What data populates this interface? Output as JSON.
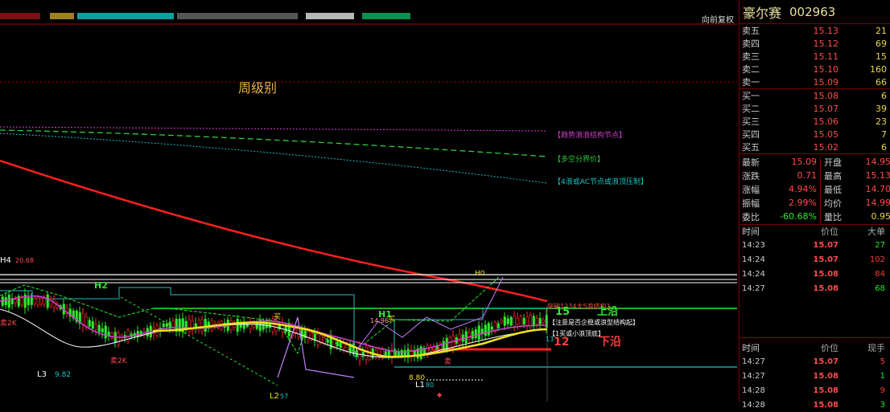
{
  "chart": {
    "adjust_label": "向前复权",
    "period_label": "周级别",
    "annotations": {
      "trend_node": "【趋势浪浪结构节点】",
      "bull_bear": "【多空分界价】",
      "wave4": "【4浪或AC节点或浪顶压制】",
      "break_up": "突破1234大5浪结构1",
      "attention": "【注意是否企稳或浪型结构起】",
      "buy": "【1买或小浪顶底】",
      "up_15": "15",
      "up_rail": "上沿",
      "down_12": "12",
      "down_rail": "下沿",
      "h4": "H4",
      "h4_val": "20.68",
      "h2": "H2",
      "h1": "H1",
      "h1_val": "14.96",
      "h0": "H0",
      "l3": "L3",
      "l3_val": "9.82",
      "l2": "L2",
      "l2_val": "57",
      "l1": "L1",
      "l1_val": "80",
      "v880": "8.80",
      "sell2k_a": "卖2K",
      "sell2k_b": "卖2K",
      "buy_a": "买",
      "buy_b": "买",
      "sell_c": "卖",
      "num13": "13"
    }
  },
  "panel": {
    "name": "豪尔赛",
    "code": "002963",
    "sell": [
      {
        "label": "卖五",
        "price": "15.13",
        "vol": "21"
      },
      {
        "label": "卖四",
        "price": "15.12",
        "vol": "69"
      },
      {
        "label": "卖三",
        "price": "15.11",
        "vol": "15"
      },
      {
        "label": "卖二",
        "price": "15.10",
        "vol": "160"
      },
      {
        "label": "卖一",
        "price": "15.09",
        "vol": "66"
      }
    ],
    "buy": [
      {
        "label": "买一",
        "price": "15.08",
        "vol": "6"
      },
      {
        "label": "买二",
        "price": "15.07",
        "vol": "39"
      },
      {
        "label": "买三",
        "price": "15.06",
        "vol": "23"
      },
      {
        "label": "买四",
        "price": "15.05",
        "vol": "7"
      },
      {
        "label": "买五",
        "price": "15.02",
        "vol": "6"
      }
    ],
    "stats": [
      {
        "k": "最新",
        "v": "15.09",
        "k2": "开盘",
        "v2": "14.95"
      },
      {
        "k": "涨跌",
        "v": "0.71",
        "k2": "最高",
        "v2": "15.13"
      },
      {
        "k": "涨幅",
        "v": "4.94%",
        "k2": "最低",
        "v2": "14.70"
      },
      {
        "k": "振幅",
        "v": "2.99%",
        "k2": "均价",
        "v2": "14.99"
      },
      {
        "k": "委比",
        "v": "-60.68%",
        "k2": "量比",
        "v2": "0.95"
      }
    ],
    "ticks1": {
      "headers": [
        "时间",
        "价位",
        "大单"
      ],
      "rows": [
        {
          "t": "14:23",
          "p": "15.07",
          "v": "27"
        },
        {
          "t": "14:24",
          "p": "15.07",
          "v": "102"
        },
        {
          "t": "14:24",
          "p": "15.08",
          "v": "84"
        },
        {
          "t": "14:27",
          "p": "15.08",
          "v": "68"
        }
      ]
    },
    "ticks2": {
      "headers": [
        "时间",
        "价位",
        "现手"
      ],
      "rows": [
        {
          "t": "14:27",
          "p": "15.07",
          "v": "5"
        },
        {
          "t": "14:27",
          "p": "15.08",
          "v": "1"
        },
        {
          "t": "14:28",
          "p": "15.08",
          "v": "9"
        },
        {
          "t": "14:28",
          "p": "15.08",
          "v": "3"
        }
      ]
    }
  }
}
